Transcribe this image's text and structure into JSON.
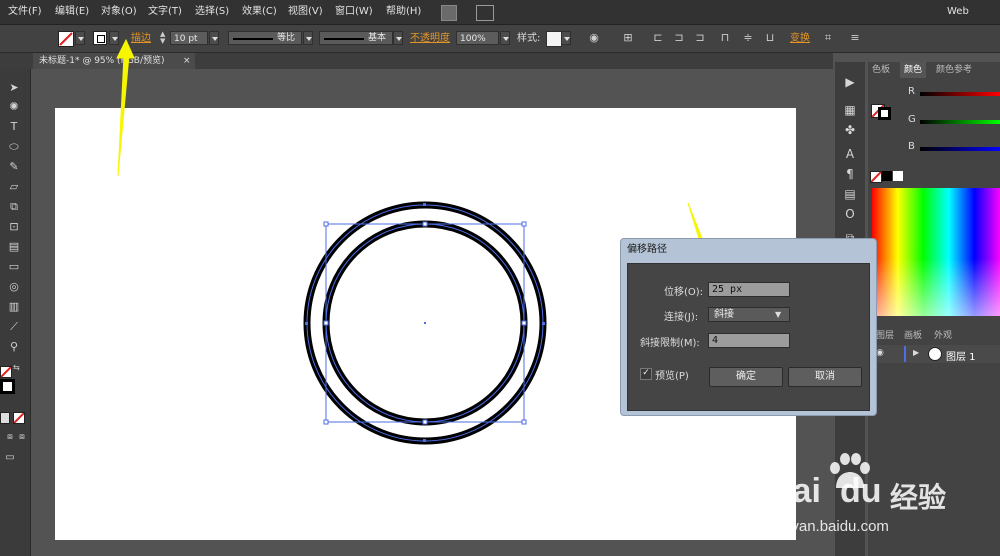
{
  "menu": [
    "文件(F)",
    "编辑(E)",
    "对象(O)",
    "文字(T)",
    "选择(S)",
    "效果(C)",
    "视图(V)",
    "窗口(W)",
    "帮助(H)"
  ],
  "workspace": "Web",
  "control_bar": {
    "stroke_label": "描边",
    "stroke_weight": "10 pt",
    "profile": "等比",
    "brush": "基本",
    "opacity_label": "不透明度",
    "opacity": "100%",
    "style_label": "样式:",
    "transform_label": "变换"
  },
  "document_tab": {
    "title": "未标题-1* @ 95% (RGB/预览)",
    "close": "×"
  },
  "right_panel": {
    "tabs": [
      "色板",
      "颜色",
      "颜色参考"
    ],
    "channels": [
      "R",
      "G",
      "B"
    ],
    "layer_tabs": [
      "图层",
      "画板",
      "外观"
    ],
    "layer_name": "图层 1"
  },
  "dialog": {
    "title": "偏移路径",
    "offset_label": "位移(O):",
    "offset_value": "25 px",
    "join_label": "连接(J):",
    "join_value": "斜接",
    "miter_label": "斜接限制(M):",
    "miter_value": "4",
    "preview_label": "预览(P)",
    "preview_checked": true,
    "ok_label": "确定",
    "cancel_label": "取消"
  },
  "colors": {
    "accent_orange": "#e39527",
    "arrow_yellow": "#f6f600",
    "selection_blue": "#4d6ee6"
  },
  "watermark": {
    "brand": "Bai",
    "brand2": "du",
    "product": "经验",
    "url": "jingyan.baidu.com"
  }
}
